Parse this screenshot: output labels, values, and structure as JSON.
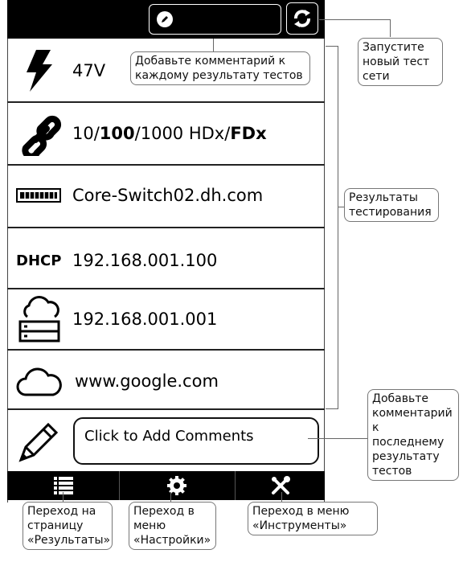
{
  "topbar": {
    "comment_icon": "pencil-icon",
    "refresh_icon": "refresh-icon"
  },
  "results": [
    {
      "name": "poe-voltage",
      "icon": "lightning-icon",
      "text": "47V"
    },
    {
      "name": "link-speed",
      "icon": "chain-link-icon",
      "parts": [
        "10/",
        "100",
        "/1000 HDx/",
        "FDx"
      ],
      "bold": [
        false,
        true,
        false,
        true
      ]
    },
    {
      "name": "switch",
      "icon": "switch-icon",
      "text": "Core-Switch02.dh.com"
    },
    {
      "name": "dhcp",
      "icon_label": "DHCP",
      "text": "192.168.001.100"
    },
    {
      "name": "gateway",
      "icon": "cloud-router-icon",
      "text": "192.168.001.001"
    },
    {
      "name": "internet",
      "icon": "cloud-icon",
      "text": "www.google.com"
    }
  ],
  "comment": {
    "icon": "pencil-large-icon",
    "text": "Click to Add Comments"
  },
  "bottom_nav": [
    {
      "icon": "list-icon"
    },
    {
      "icon": "gear-icon"
    },
    {
      "icon": "tools-icon"
    }
  ],
  "callouts": {
    "add_comment_each": "Добавьте комментарий к каждому результату тестов",
    "run_new_test": "Запустите новый тест сети",
    "test_results": "Результаты тестирования",
    "add_comment_last": "Добавьте комментарий к последнему результату тестов",
    "go_results": "Переход на страницу «Результаты»",
    "go_settings": "Переход в меню «Настройки»",
    "go_tools": "Переход в меню «Инструменты»"
  }
}
